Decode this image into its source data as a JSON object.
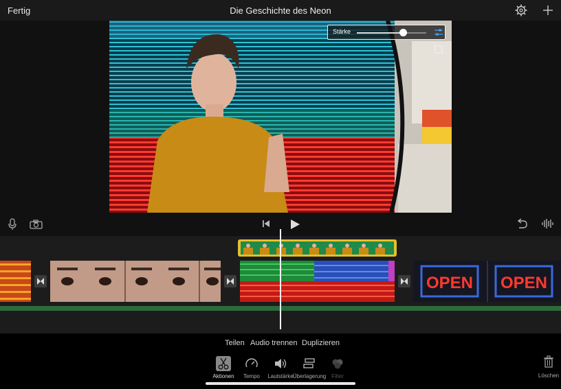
{
  "header": {
    "done_label": "Fertig",
    "project_title": "Die Geschichte des Neon"
  },
  "viewer": {
    "strength_label": "Stärke",
    "strength_value": 0.66
  },
  "timeline": {
    "clips": [
      "neon-lights",
      "eyes-closeup",
      "neon-green-screen",
      "open-sign"
    ],
    "overlay_clip": "presenter-overlay"
  },
  "actions": {
    "share": "Teilen",
    "detach_audio": "Audio trennen",
    "duplicate": "Duplizieren"
  },
  "tools": {
    "actions": "Aktionen",
    "tempo": "Tempo",
    "volume": "Lautstärke",
    "overlay": "Überlagerung",
    "filter": "Filter",
    "delete": "Löschen"
  },
  "colors": {
    "overlay_clip": "#e5c02a",
    "audio_track": "#2b6a3a",
    "background": "#000000"
  }
}
